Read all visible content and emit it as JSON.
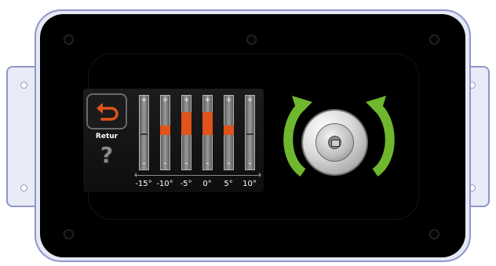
{
  "screen": {
    "back_label": "Retur",
    "back_icon": "return-arrow-icon",
    "help_label": "?",
    "accent_color": "#e0531a",
    "slider_plus": "+",
    "slider_minus": "-",
    "sliders": [
      {
        "label": "-15°",
        "level": 0.0
      },
      {
        "label": "-10°",
        "level": 0.12
      },
      {
        "label": "-5°",
        "level": 0.3
      },
      {
        "label": "0°",
        "level": 0.3
      },
      {
        "label": "5°",
        "level": 0.12
      },
      {
        "label": "10°",
        "level": 0.0
      }
    ]
  },
  "knob": {
    "icon": "rotary-knob-icon",
    "arrow_color": "#6fb82e"
  }
}
